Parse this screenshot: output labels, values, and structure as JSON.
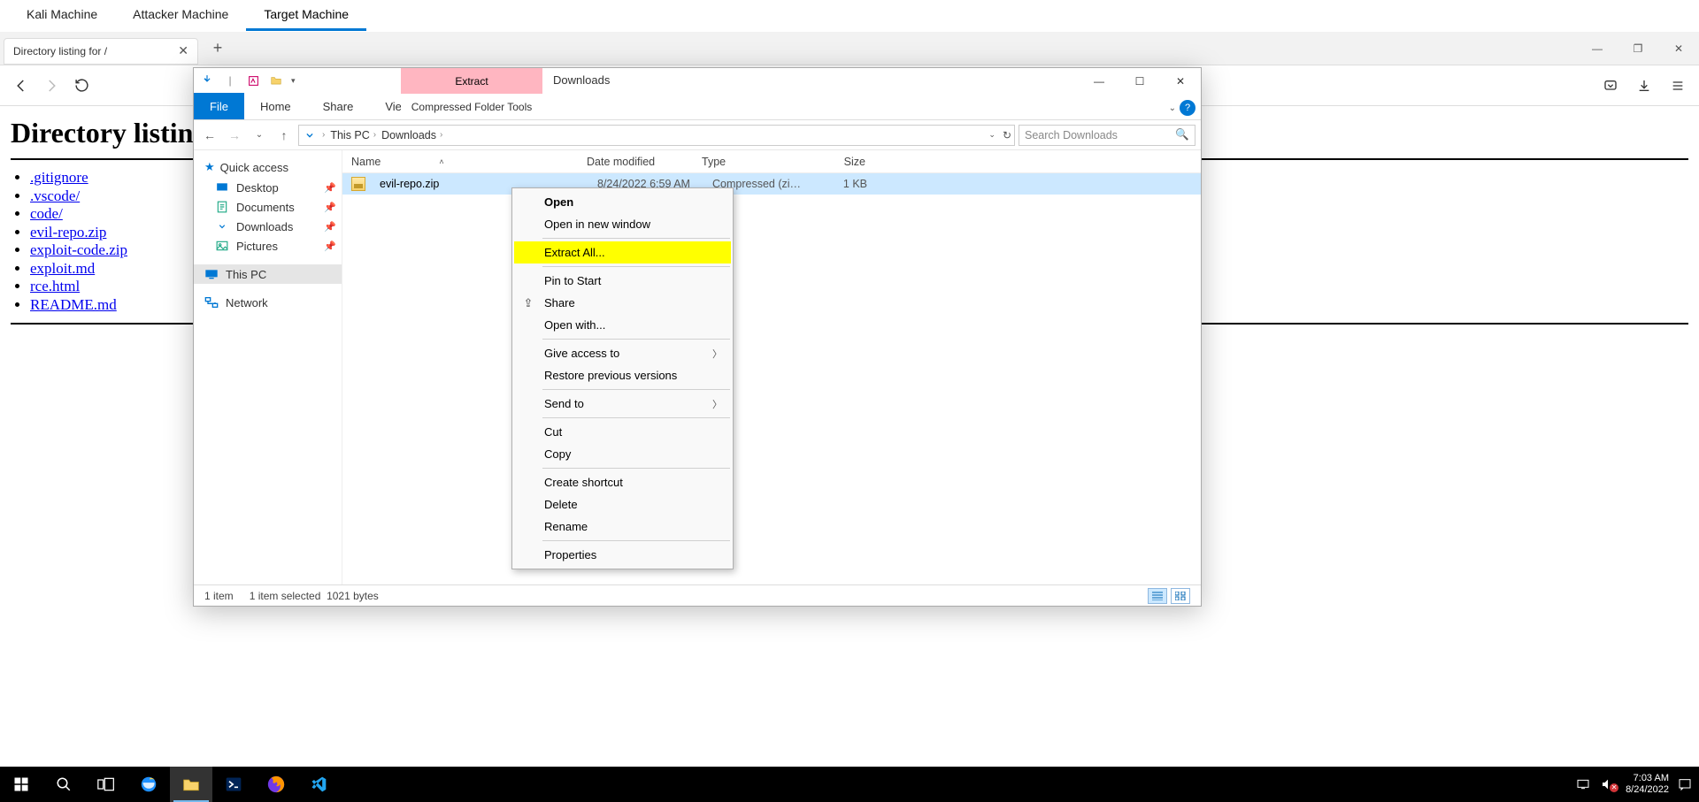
{
  "lab_tabs": [
    "Kali Machine",
    "Attacker Machine",
    "Target Machine"
  ],
  "lab_active_index": 2,
  "browser": {
    "tab_title": "Directory listing for /",
    "page_heading": "Directory listin",
    "listing": [
      ".gitignore",
      ".vscode/",
      "code/",
      "evil-repo.zip",
      "exploit-code.zip",
      "exploit.md",
      "rce.html",
      "README.md"
    ]
  },
  "browser_window": {
    "minimize": "—",
    "restore": "❐",
    "close": "✕"
  },
  "explorer": {
    "context_tab_top": "Extract",
    "context_tab_bottom": "Compressed Folder Tools",
    "title": "Downloads",
    "ribbon_tabs": {
      "file": "File",
      "home": "Home",
      "share": "Share",
      "view": "View"
    },
    "breadcrumb": [
      "This PC",
      "Downloads"
    ],
    "search_placeholder": "Search Downloads",
    "nav": {
      "quick": "Quick access",
      "desktop": "Desktop",
      "documents": "Documents",
      "downloads": "Downloads",
      "pictures": "Pictures",
      "this_pc": "This PC",
      "network": "Network"
    },
    "columns": {
      "name": "Name",
      "date": "Date modified",
      "type": "Type",
      "size": "Size"
    },
    "file": {
      "name": "evil-repo.zip",
      "date": "8/24/2022 6:59 AM",
      "type": "Compressed (zipp...",
      "size": "1 KB"
    },
    "status": {
      "count": "1 item",
      "selected": "1 item selected",
      "bytes": "1021 bytes"
    }
  },
  "context_menu": {
    "open": "Open",
    "open_new": "Open in new window",
    "extract": "Extract All...",
    "pin": "Pin to Start",
    "share": "Share",
    "open_with": "Open with...",
    "give_access": "Give access to",
    "restore": "Restore previous versions",
    "send_to": "Send to",
    "cut": "Cut",
    "copy": "Copy",
    "shortcut": "Create shortcut",
    "delete": "Delete",
    "rename": "Rename",
    "properties": "Properties"
  },
  "taskbar": {
    "time": "7:03 AM",
    "date": "8/24/2022"
  }
}
